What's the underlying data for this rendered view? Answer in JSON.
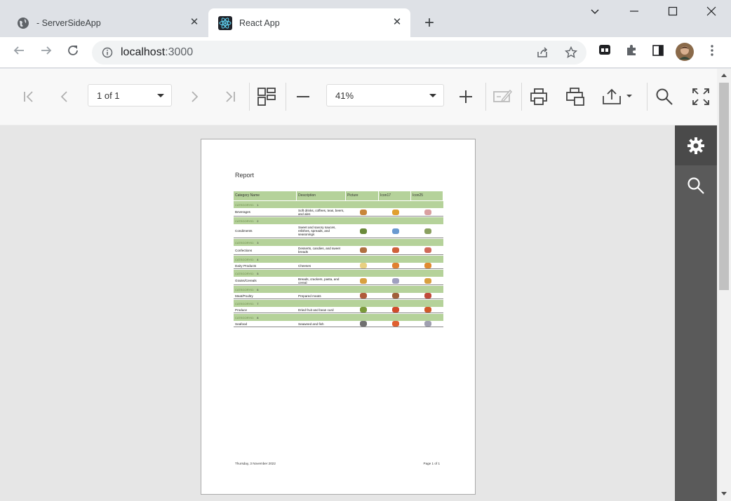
{
  "tabs": [
    {
      "title": "- ServerSideApp",
      "icon": "globe-icon"
    },
    {
      "title": "React App",
      "icon": "react-icon"
    }
  ],
  "address": {
    "host": "localhost",
    "port": ":3000"
  },
  "viewer": {
    "page_select": "1 of 1",
    "zoom_select": "41%"
  },
  "report": {
    "title": "Report",
    "columns": [
      "Category Name",
      "Description",
      "Picture",
      "Icon17",
      "Icon25"
    ],
    "group_label": "CATEGORYID:",
    "rows": [
      {
        "id": "1",
        "name": "Beverages",
        "desc": "Soft drinks, coffees, teas, beers, and ales",
        "colors": [
          "#c8863a",
          "#e0a030",
          "#d9a0a0"
        ]
      },
      {
        "id": "2",
        "name": "Condiments",
        "desc": "Sweet and savory sauces, relishes, spreads, and seasonings",
        "colors": [
          "#6a8a3a",
          "#6a9ad0",
          "#8aa060"
        ]
      },
      {
        "id": "3",
        "name": "Confections",
        "desc": "Desserts, candies, and sweet breads",
        "colors": [
          "#b07040",
          "#d0603a",
          "#d06a5a"
        ]
      },
      {
        "id": "4",
        "name": "Dairy Products",
        "desc": "Cheeses",
        "colors": [
          "#e8d080",
          "#e08030",
          "#e08a30"
        ]
      },
      {
        "id": "5",
        "name": "Grains/Cereals",
        "desc": "Breads, crackers, pasta, and cereal",
        "colors": [
          "#d8a040",
          "#a0a0c0",
          "#d8a040"
        ]
      },
      {
        "id": "6",
        "name": "Meat/Poultry",
        "desc": "Prepared meats",
        "colors": [
          "#b05a3a",
          "#a0603a",
          "#c04a3a"
        ]
      },
      {
        "id": "7",
        "name": "Produce",
        "desc": "Dried fruit and bean curd",
        "colors": [
          "#7a9a3a",
          "#d04a2a",
          "#d05a2a"
        ]
      },
      {
        "id": "8",
        "name": "Seafood",
        "desc": "Seaweed and fish",
        "colors": [
          "#707070",
          "#e06030",
          "#a0a0b0"
        ]
      }
    ],
    "footer_date": "Thursday, 3 November 2022",
    "footer_page": "Page 1 of 1"
  }
}
